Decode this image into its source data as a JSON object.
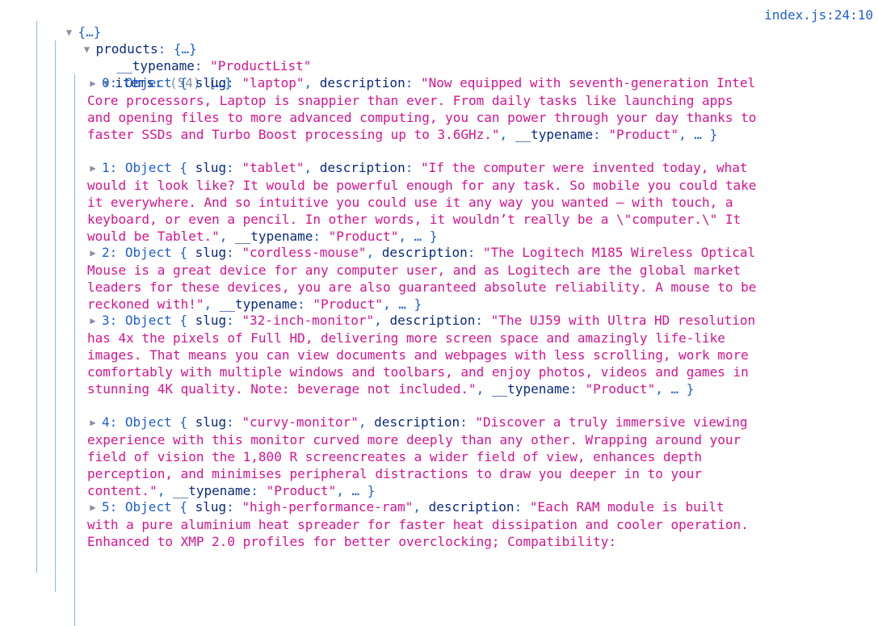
{
  "console": {
    "source_link": "index.js:24:10",
    "root_label": "{…}",
    "products_key": "products",
    "products_preview": "{…}",
    "typename_key": "__typename",
    "typename_value": "\"ProductList\"",
    "items_key": "items",
    "items_count": "(54)",
    "items_preview": "[…]",
    "items": [
      {
        "index": "0",
        "type": "Object",
        "slug": "\"laptop\"",
        "description": "\"Now equipped with seventh-generation Intel Core processors, Laptop is snappier than ever. From daily tasks like launching apps and opening files to more advanced computing, you can power through your day thanks to faster SSDs and Turbo Boost processing up to 3.6GHz.\"",
        "typename": "\"Product\""
      },
      {
        "index": "1",
        "type": "Object",
        "slug": "\"tablet\"",
        "description": "\"If the computer were invented today, what would it look like? It would be powerful enough for any task. So mobile you could take it everywhere. And so intuitive you could use it any way you wanted — with touch, a keyboard, or even a pencil. In other words, it wouldn’t really be a \\\"computer.\\\" It would be Tablet.\"",
        "typename": "\"Product\""
      },
      {
        "index": "2",
        "type": "Object",
        "slug": "\"cordless-mouse\"",
        "description": "\"The Logitech M185 Wireless Optical Mouse is a great device for any computer user, and as Logitech are the global market leaders for these devices, you are also guaranteed absolute reliability. A mouse to be reckoned with!\"",
        "typename": "\"Product\""
      },
      {
        "index": "3",
        "type": "Object",
        "slug": "\"32-inch-monitor\"",
        "description": "\"The UJ59 with Ultra HD resolution has 4x the pixels of Full HD, delivering more screen space and amazingly life-like images. That means you can view documents and webpages with less scrolling, work more comfortably with multiple windows and toolbars, and enjoy photos, videos and games in stunning 4K quality. Note: beverage not included.\"",
        "typename": "\"Product\""
      },
      {
        "index": "4",
        "type": "Object",
        "slug": "\"curvy-monitor\"",
        "description": "\"Discover a truly immersive viewing experience with this monitor curved more deeply than any other. Wrapping around your field of vision the 1,800 R screencreates a wider field of view, enhances depth perception, and minimises peripheral distractions to draw you deeper in to your content.\"",
        "typename": "\"Product\""
      },
      {
        "index": "5",
        "type": "Object",
        "slug": "\"high-performance-ram\"",
        "description": "\"Each RAM module is built with a pure aluminium heat spreader for faster heat dissipation and cooler operation. Enhanced to XMP 2.0 profiles for better overclocking; Compatibility:",
        "typename": ""
      }
    ],
    "labels": {
      "slug_key": "slug",
      "description_key": "description",
      "typename_key": "__typename",
      "ellipsis": "…"
    },
    "icons": {
      "expanded": "triangle-down-icon",
      "collapsed": "triangle-right-icon"
    },
    "colors": {
      "key": "#0b2a80",
      "string": "#d6138f",
      "link": "#1f5fd0",
      "muted": "#8a8fa3",
      "rail": "#8fb8f0"
    }
  }
}
